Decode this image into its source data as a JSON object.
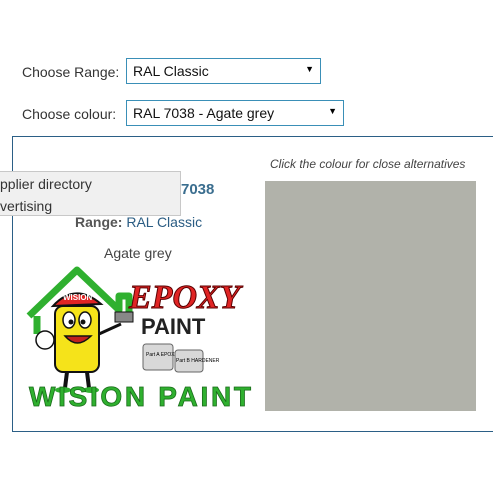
{
  "form": {
    "range_label": "Choose Range:",
    "range_value": "RAL Classic",
    "colour_label": "Choose colour:",
    "colour_value": "RAL 7038 - Agate grey",
    "dropdown_arrow": "▼"
  },
  "panel": {
    "hint": "Click the colour for close alternatives",
    "code": "7038",
    "range_prefix": "Range:",
    "range_link": "RAL Classic",
    "colour_name": "Agate grey",
    "swatch_color": "#b1b2aa"
  },
  "popup": {
    "items": [
      "pplier directory",
      "vertising"
    ]
  },
  "logo": {
    "word1": "EPOXY",
    "word2": "PAINT",
    "brand": "WISION PAINT",
    "cap": "WISION",
    "can_a": "Part A EPOXY",
    "can_b": "Part B HARDENER"
  }
}
